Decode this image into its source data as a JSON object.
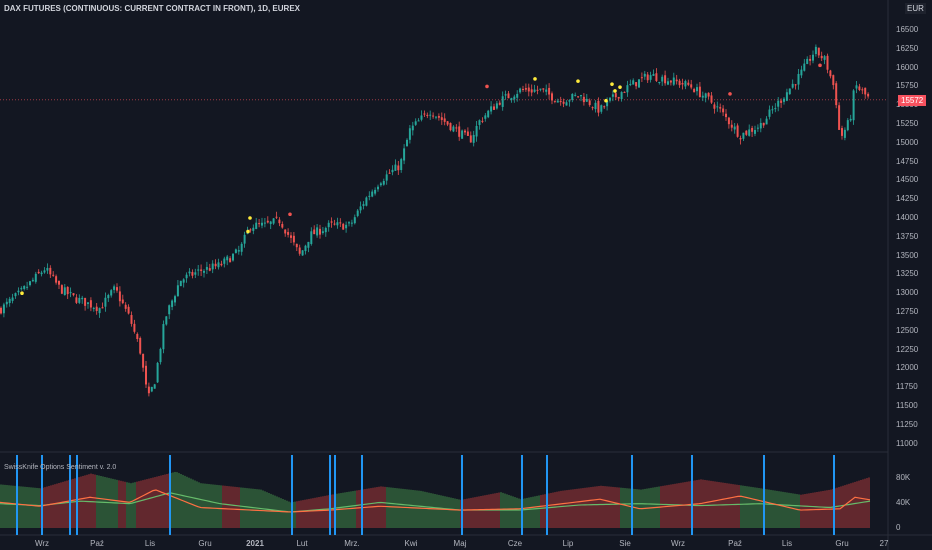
{
  "header": {
    "title": "DAX FUTURES (CONTINUOUS: CURRENT CONTRACT IN FRONT), 1D, EUREX",
    "currency": "EUR",
    "last_price": "15572"
  },
  "indicator": {
    "title": "SwissKnife Options Sentiment v. 2.0",
    "axis": [
      "80K",
      "40K",
      "0"
    ]
  },
  "colors": {
    "bg": "#131722",
    "up": "#26a69a",
    "down": "#ef5350",
    "signal": "#ffeb3b",
    "vline": "#2196f3"
  },
  "chart_data": {
    "type": "candlestick",
    "y_ticks": [
      "16500",
      "16250",
      "16000",
      "15750",
      "15500",
      "15250",
      "15000",
      "14750",
      "14500",
      "14250",
      "14000",
      "13750",
      "13500",
      "13250",
      "13000",
      "12750",
      "12500",
      "12250",
      "12000",
      "11750",
      "11500",
      "11250",
      "11000"
    ],
    "ylim": [
      11000,
      16500
    ],
    "x_ticks": [
      "Wrz",
      "Paź",
      "Lis",
      "Gru",
      "2021",
      "Lut",
      "Mrz.",
      "Kwi",
      "Maj",
      "Cze",
      "Lip",
      "Sie",
      "Wrz",
      "Paź",
      "Lis",
      "Gru",
      "27"
    ],
    "price_path_approx": [
      [
        0,
        12780
      ],
      [
        20,
        13000
      ],
      [
        45,
        13330
      ],
      [
        60,
        13060
      ],
      [
        75,
        12930
      ],
      [
        100,
        12800
      ],
      [
        115,
        13060
      ],
      [
        130,
        12660
      ],
      [
        140,
        12250
      ],
      [
        148,
        11580
      ],
      [
        155,
        11850
      ],
      [
        165,
        12660
      ],
      [
        180,
        13170
      ],
      [
        200,
        13300
      ],
      [
        220,
        13370
      ],
      [
        240,
        13570
      ],
      [
        250,
        13900
      ],
      [
        265,
        13900
      ],
      [
        280,
        13970
      ],
      [
        300,
        13500
      ],
      [
        310,
        13770
      ],
      [
        330,
        13900
      ],
      [
        350,
        13900
      ],
      [
        365,
        14240
      ],
      [
        380,
        14500
      ],
      [
        400,
        14700
      ],
      [
        410,
        15170
      ],
      [
        430,
        15430
      ],
      [
        450,
        15230
      ],
      [
        470,
        15030
      ],
      [
        480,
        15300
      ],
      [
        500,
        15560
      ],
      [
        520,
        15700
      ],
      [
        540,
        15700
      ],
      [
        560,
        15560
      ],
      [
        580,
        15630
      ],
      [
        600,
        15430
      ],
      [
        610,
        15560
      ],
      [
        630,
        15760
      ],
      [
        650,
        15900
      ],
      [
        670,
        15830
      ],
      [
        690,
        15760
      ],
      [
        710,
        15560
      ],
      [
        720,
        15430
      ],
      [
        740,
        15100
      ],
      [
        760,
        15230
      ],
      [
        780,
        15560
      ],
      [
        800,
        15900
      ],
      [
        815,
        16230
      ],
      [
        825,
        16100
      ],
      [
        835,
        15700
      ],
      [
        840,
        15050
      ],
      [
        850,
        15300
      ],
      [
        855,
        15770
      ],
      [
        870,
        15572
      ]
    ],
    "indicator_area_K": [
      [
        0,
        68
      ],
      [
        40,
        62
      ],
      [
        90,
        85
      ],
      [
        130,
        70
      ],
      [
        175,
        88
      ],
      [
        200,
        70
      ],
      [
        260,
        60
      ],
      [
        290,
        40
      ],
      [
        330,
        52
      ],
      [
        380,
        65
      ],
      [
        420,
        58
      ],
      [
        460,
        44
      ],
      [
        500,
        56
      ],
      [
        520,
        45
      ],
      [
        560,
        58
      ],
      [
        600,
        66
      ],
      [
        640,
        60
      ],
      [
        700,
        76
      ],
      [
        760,
        62
      ],
      [
        800,
        52
      ],
      [
        830,
        60
      ],
      [
        870,
        80
      ]
    ],
    "indicator_red_ranges": [
      [
        40,
        95
      ],
      [
        118,
        126
      ],
      [
        135,
        170
      ],
      [
        222,
        240
      ],
      [
        295,
        335
      ],
      [
        355,
        385
      ],
      [
        460,
        500
      ],
      [
        540,
        620
      ],
      [
        660,
        740
      ],
      [
        800,
        870
      ]
    ],
    "line_green_K": [
      [
        0,
        38
      ],
      [
        40,
        35
      ],
      [
        80,
        42
      ],
      [
        130,
        38
      ],
      [
        170,
        55
      ],
      [
        220,
        38
      ],
      [
        290,
        25
      ],
      [
        330,
        30
      ],
      [
        380,
        40
      ],
      [
        460,
        28
      ],
      [
        520,
        28
      ],
      [
        580,
        36
      ],
      [
        640,
        38
      ],
      [
        700,
        35
      ],
      [
        760,
        38
      ],
      [
        830,
        32
      ],
      [
        870,
        42
      ]
    ],
    "line_orange_K": [
      [
        0,
        40
      ],
      [
        40,
        34
      ],
      [
        90,
        48
      ],
      [
        130,
        40
      ],
      [
        155,
        60
      ],
      [
        200,
        32
      ],
      [
        290,
        25
      ],
      [
        330,
        28
      ],
      [
        380,
        34
      ],
      [
        460,
        28
      ],
      [
        520,
        30
      ],
      [
        600,
        45
      ],
      [
        640,
        30
      ],
      [
        700,
        38
      ],
      [
        740,
        50
      ],
      [
        800,
        28
      ],
      [
        840,
        30
      ],
      [
        855,
        48
      ],
      [
        870,
        44
      ]
    ],
    "signal_lines_x_days": [
      17,
      42,
      70,
      77,
      170,
      292,
      330,
      335,
      362,
      462,
      522,
      547,
      632,
      692,
      764,
      834
    ]
  }
}
